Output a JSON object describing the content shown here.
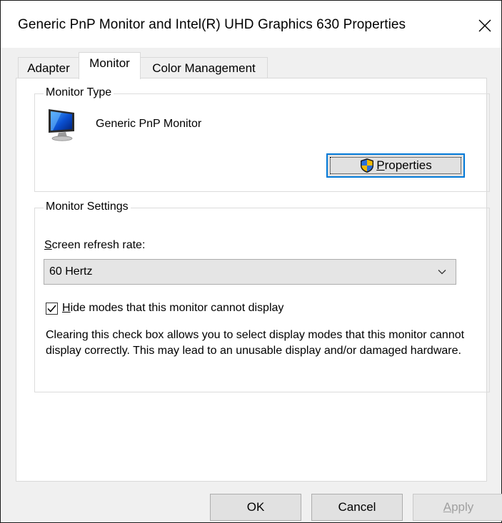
{
  "window": {
    "title": "Generic PnP Monitor and Intel(R) UHD Graphics 630 Properties"
  },
  "tabs": [
    {
      "label": "Adapter",
      "selected": false
    },
    {
      "label": "Monitor",
      "selected": true
    },
    {
      "label": "Color Management",
      "selected": false
    }
  ],
  "monitor_type": {
    "legend": "Monitor Type",
    "monitor_name": "Generic PnP Monitor",
    "properties_button": {
      "label_accel": "P",
      "label_rest": "roperties"
    }
  },
  "monitor_settings": {
    "legend": "Monitor Settings",
    "refresh_label_accel": "S",
    "refresh_label_rest": "creen refresh rate:",
    "refresh_value": "60 Hertz",
    "hide_modes": {
      "checked": true,
      "label_accel": "H",
      "label_rest": "ide modes that this monitor cannot display"
    },
    "warning": "Clearing this check box allows you to select display modes that this monitor cannot display correctly. This may lead to an unusable display and/or damaged hardware."
  },
  "footer": {
    "ok_label": "OK",
    "cancel_label": "Cancel",
    "apply_label_accel": "A",
    "apply_label_rest": "pply",
    "apply_enabled": false
  },
  "colors": {
    "focus_border": "#0078d7",
    "button_face": "#e1e1e1",
    "disabled_text": "#a0a0a0"
  }
}
